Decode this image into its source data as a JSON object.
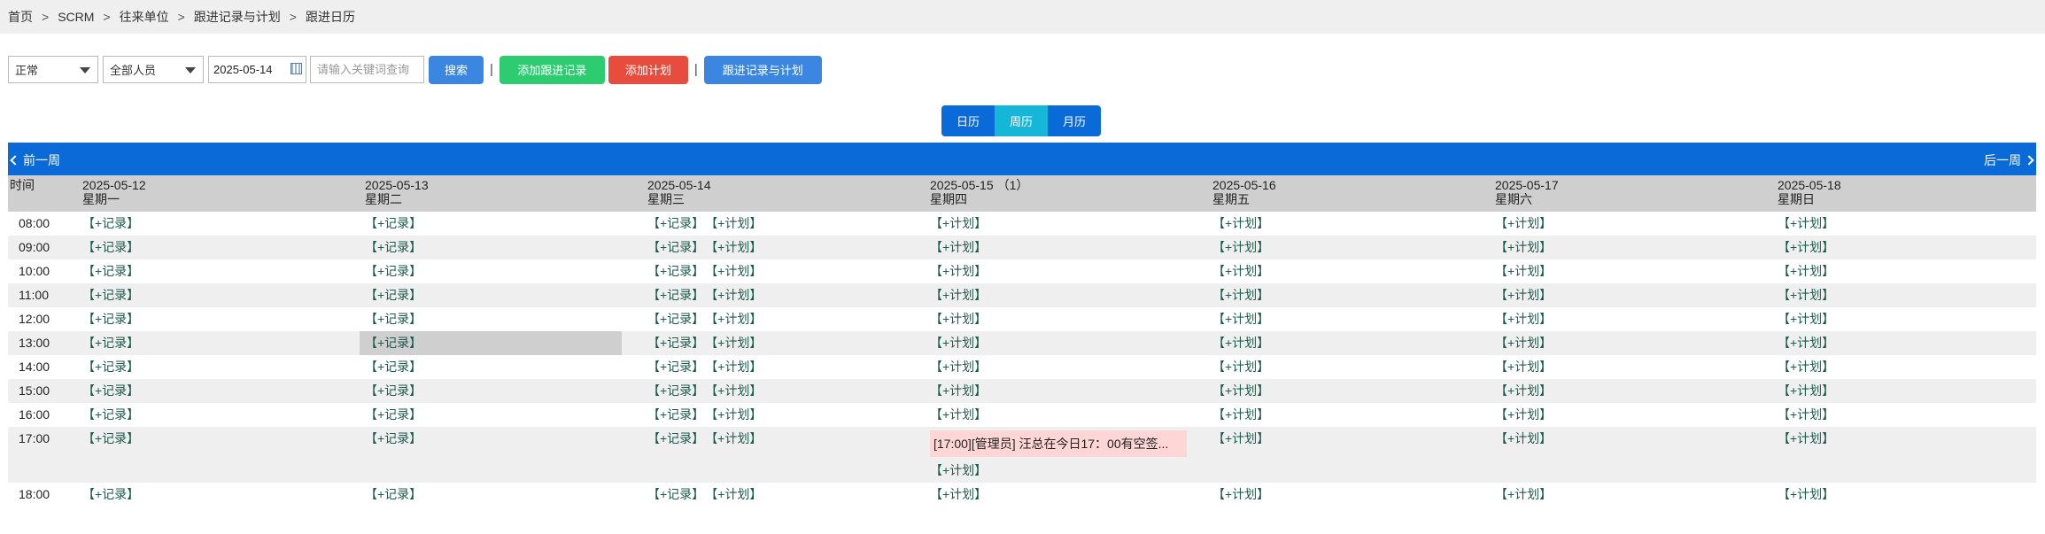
{
  "breadcrumb": [
    "首页",
    "SCRM",
    "往来单位",
    "跟进记录与计划",
    "跟进日历"
  ],
  "breadcrumb_sep": ">",
  "toolbar": {
    "status_select": "正常",
    "person_select": "全部人员",
    "date_value": "2025-05-14",
    "search_placeholder": "请输入关键词查询",
    "search_label": "搜索",
    "add_record_label": "添加跟进记录",
    "add_plan_label": "添加计划",
    "records_plans_label": "跟进记录与计划",
    "pipe": "|"
  },
  "colors": {
    "search": "#3a86e0",
    "add_record": "#2ecc71",
    "add_plan": "#e74c3c",
    "records_plans": "#3a86e0",
    "nav": "#0a6ad8",
    "active_view": "#16b6d8",
    "event": "#ffd6d6"
  },
  "views": [
    {
      "label": "日历",
      "active": false
    },
    {
      "label": "周历",
      "active": true
    },
    {
      "label": "月历",
      "active": false
    }
  ],
  "nav": {
    "prev": "前一周",
    "next": "后一周"
  },
  "calendar": {
    "time_header": "时间",
    "days": [
      {
        "date": "2025-05-12",
        "weekday": "星期一",
        "count": ""
      },
      {
        "date": "2025-05-13",
        "weekday": "星期二",
        "count": ""
      },
      {
        "date": "2025-05-14",
        "weekday": "星期三",
        "count": ""
      },
      {
        "date": "2025-05-15",
        "weekday": "星期四",
        "count": "（1）"
      },
      {
        "date": "2025-05-16",
        "weekday": "星期五",
        "count": ""
      },
      {
        "date": "2025-05-17",
        "weekday": "星期六",
        "count": ""
      },
      {
        "date": "2025-05-18",
        "weekday": "星期日",
        "count": ""
      }
    ],
    "hours": [
      "08:00",
      "09:00",
      "10:00",
      "11:00",
      "12:00",
      "13:00",
      "14:00",
      "15:00",
      "16:00",
      "17:00",
      "18:00"
    ],
    "record_link": "【+记录】",
    "plan_link": "【+计划】",
    "day_links": [
      [
        "record"
      ],
      [
        "record"
      ],
      [
        "record",
        "plan"
      ],
      [
        "plan"
      ],
      [
        "plan"
      ],
      [
        "plan"
      ],
      [
        "plan"
      ]
    ],
    "highlight": {
      "day": 1,
      "hour": "13:00"
    },
    "events": [
      {
        "day": 3,
        "hour": "17:00",
        "text": "[17:00][管理员] 汪总在今日17：00有空签..."
      }
    ]
  }
}
